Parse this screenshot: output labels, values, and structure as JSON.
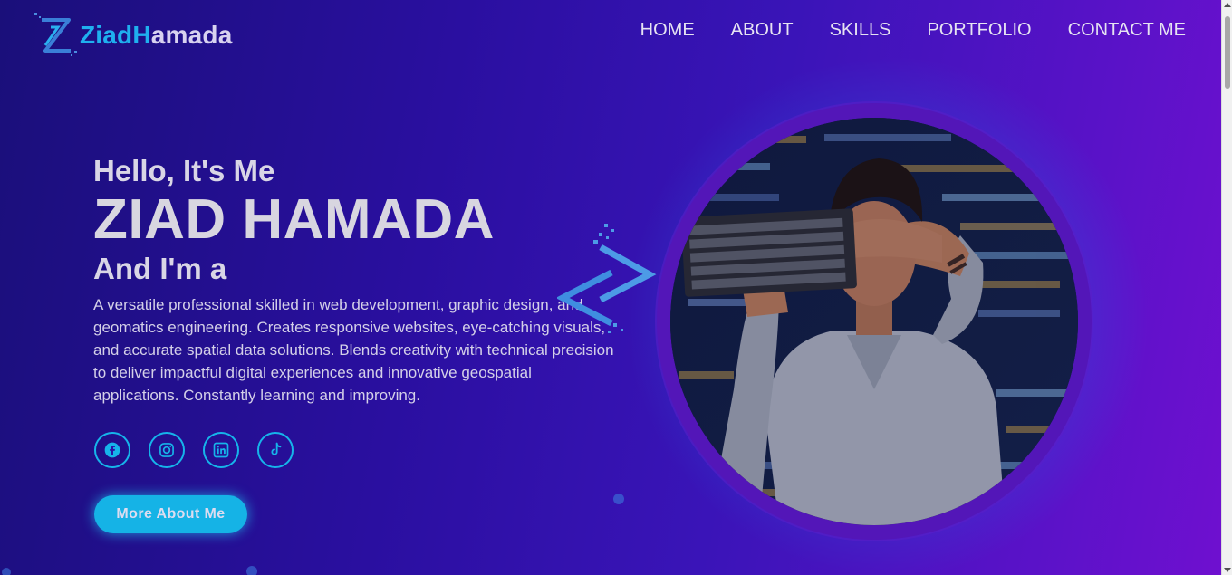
{
  "brand": {
    "logo_initial": "Z",
    "name_first": "Ziad",
    "name_h": "H",
    "name_rest": "amada"
  },
  "nav": {
    "items": [
      "HOME",
      "ABOUT",
      "SKILLS",
      "PORTFOLIO",
      "CONTACT ME"
    ]
  },
  "hero": {
    "greeting": "Hello, It's Me",
    "name": "ZIAD HAMADA",
    "role_prefix": "And I'm a",
    "description": "A versatile professional skilled in web development, graphic design, and geomatics engineering. Creates responsive websites, eye-catching visuals, and accurate spatial data solutions. Blends creativity with technical precision to deliver impactful digital experiences and innovative geospatial applications. Constantly learning and improving.",
    "cta_label": "More About Me"
  },
  "socials": [
    {
      "name": "facebook-icon"
    },
    {
      "name": "instagram-icon"
    },
    {
      "name": "linkedin-icon"
    },
    {
      "name": "tiktok-icon"
    }
  ],
  "colors": {
    "accent": "#16b4ea",
    "bg_start": "#1a0f7a",
    "bg_end": "#7010d0",
    "ring": "#5316b8"
  }
}
